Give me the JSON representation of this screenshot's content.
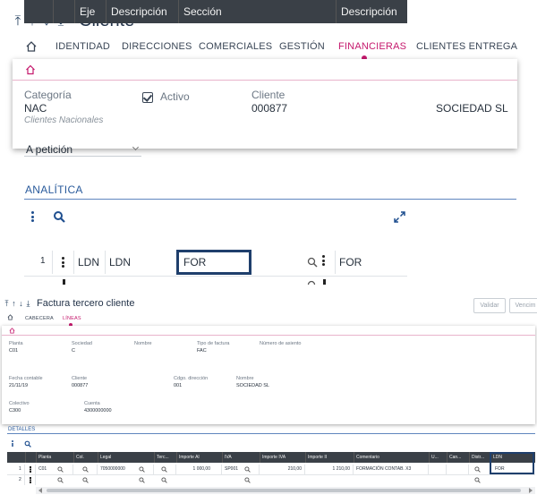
{
  "top": {
    "title": "Cliente",
    "tabs": [
      "IDENTIDAD",
      "DIRECCIONES",
      "COMERCIALES",
      "GESTIÓN",
      "FINANCIERAS",
      "CLIENTES ENTREGA"
    ],
    "active_tab": "FINANCIERAS",
    "accent_color": "#c5196d",
    "popup": {
      "categoria_label": "Categoría",
      "categoria_value": "NAC",
      "categoria_desc": "Clientes Nacionales",
      "activo_label": "Activo",
      "activo_checked": true,
      "cliente_label": "Cliente",
      "cliente_value": "000877",
      "sociedad_value": "SOCIEDAD SL"
    },
    "select_partial": "A petición",
    "section_title": "ANALÍTICA",
    "grid": {
      "headers": [
        "",
        "",
        "Eje",
        "Descripción",
        "Sección",
        "Descripción"
      ],
      "row": {
        "num": "1",
        "eje": "LDN",
        "descripcion": "LDN",
        "seccion": "FOR",
        "descripcion2": "FOR"
      }
    }
  },
  "bottom": {
    "title": "Factura tercero cliente",
    "buttons": [
      "Validar",
      "Vencim"
    ],
    "tabs": [
      "CABECERA",
      "LÍNEAS"
    ],
    "active_tab": "LÍNEAS",
    "fields": {
      "planta_label": "Planta",
      "planta_value": "C01",
      "sociedad_label": "Sociedad",
      "sociedad_value": "C",
      "nombre_label": "Nombre",
      "tipo_factura_label": "Tipo de factura",
      "tipo_factura_value": "FAC",
      "numero_asiento_label": "Número de asiento",
      "fecha_contable_label": "Fecha contable",
      "fecha_contable_value": "21/11/19",
      "cliente_label": "Cliente",
      "cliente_value": "000877",
      "cdgo_direccion_label": "Cdgo. dirección",
      "cdgo_direccion_value": "001",
      "nombre2_label": "Nombre",
      "nombre2_value": "SOCIEDAD SL",
      "colectivo_label": "Colectivo",
      "colectivo_value": "C300",
      "cuenta_label": "Cuenta",
      "cuenta_value": "4300000000"
    },
    "section_title": "DETALLES",
    "grid": {
      "headers": [
        "Planta",
        "Col.",
        "Legal",
        "Terc...",
        "Importe AI",
        "IVA",
        "Importe IVA",
        "Importe II",
        "Comentario",
        "U...",
        "Can...",
        "Distr...",
        "LDN"
      ],
      "row1": {
        "num": "1",
        "planta": "C01",
        "legal": "7050000000",
        "importe_ai": "1 000,00",
        "iva": "SP001",
        "importe_iva": "210,00",
        "importe_ii": "1 210,00",
        "comentario": "FORMACIÓN CONTAB. X3",
        "ldn": "FOR"
      },
      "row2": {
        "num": "2"
      }
    }
  }
}
